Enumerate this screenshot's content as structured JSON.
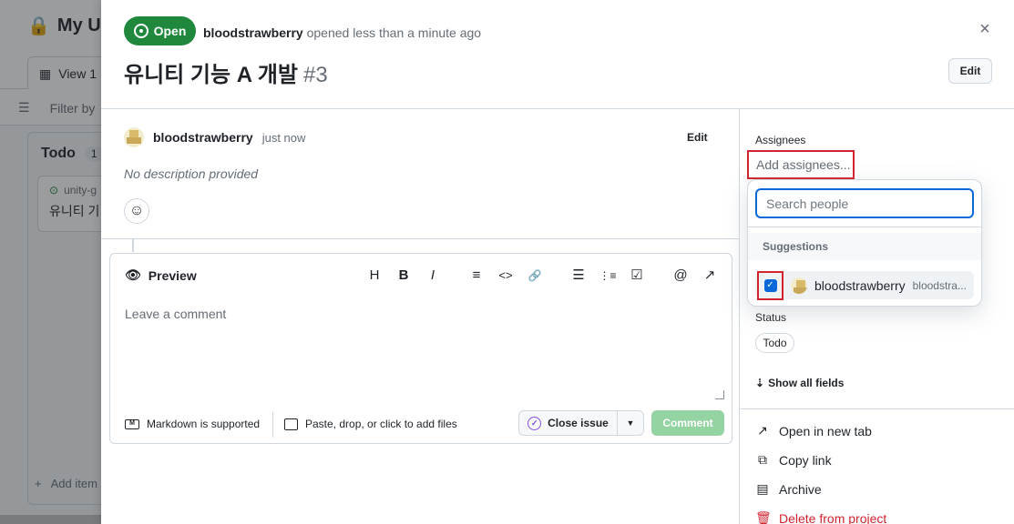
{
  "background": {
    "project_title": "My Un",
    "view_tab": "View 1",
    "filter_placeholder": "Filter by",
    "column_title": "Todo",
    "column_count": "1",
    "card_repo": "unity-g",
    "card_title": "유니티 기",
    "add_item": "Add item"
  },
  "header": {
    "status": "Open",
    "author": "bloodstrawberry",
    "opened_text": "opened less than a minute ago",
    "title": "유니티 기능 A 개발",
    "number": "#3",
    "edit_label": "Edit",
    "close_glyph": "×"
  },
  "comment": {
    "author": "bloodstrawberry",
    "time": "just now",
    "edit_label": "Edit",
    "body": "No description provided"
  },
  "editor": {
    "preview_label": "Preview",
    "toolbar": [
      "H",
      "B",
      "I",
      "≡",
      "<>",
      "🔗",
      "☰",
      "⋮≡",
      "☑",
      "@",
      "↗"
    ],
    "placeholder": "Leave a comment",
    "markdown_note": "Markdown is supported",
    "paste_note": "Paste, drop, or click to add files",
    "close_issue_label": "Close issue",
    "comment_label": "Comment"
  },
  "sidebar": {
    "assignees_label": "Assignees",
    "add_assignees": "Add assignees...",
    "status_label": "Status",
    "status_value": "Todo",
    "show_all_fields": "Show all fields",
    "actions": {
      "open_new_tab": "Open in new tab",
      "copy_link": "Copy link",
      "archive": "Archive",
      "delete": "Delete from project"
    }
  },
  "popover": {
    "search_placeholder": "Search people",
    "suggestions_label": "Suggestions",
    "suggestion_name": "bloodstrawberry",
    "suggestion_login": "bloodstra..."
  }
}
